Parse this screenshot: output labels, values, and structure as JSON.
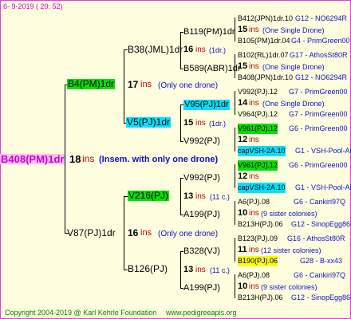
{
  "header": {
    "date": "6-  9-2019 ( 20: 52)"
  },
  "root": {
    "name": "B408(PM)1dr",
    "num": "18",
    "ins": "ins",
    "note": "(Insem. with only one drone)"
  },
  "gen1": [
    {
      "name": "B4(PM)1dr",
      "num": "17",
      "ins": "ins",
      "note": "(Only one drone)"
    },
    {
      "name": "V87(PJ)1dr",
      "num": "16",
      "ins": "ins",
      "note": "(Only one drone)"
    }
  ],
  "gen2": [
    {
      "name": "B38(JML)1dr",
      "num": "16",
      "ins": "ins",
      "note": "(1dr.)"
    },
    {
      "name": "V5(PJ)1dr",
      "num": "15",
      "ins": "ins",
      "note": "(1dr.)"
    },
    {
      "name": "V216(PJ)",
      "num": "13",
      "ins": "ins",
      "note": "(11 c.)"
    },
    {
      "name": "B126(PJ)",
      "num": "13",
      "ins": "ins",
      "note": "(11 c.)"
    }
  ],
  "gen3": [
    {
      "name": "B119(PM)1dr",
      "num": "15",
      "ins": "ins",
      "note": "(One Single Drone)"
    },
    {
      "name": "B589(ABR)1dr",
      "num": "15",
      "ins": "ins",
      "note": "(One Single Drone)"
    },
    {
      "name": "V95(PJ)1dr",
      "num": "14",
      "ins": "ins",
      "note": "(One Single Drone)"
    },
    {
      "name": "V992(PJ)",
      "num": "12",
      "ins": "ins",
      "note": ""
    },
    {
      "name": "V992(PJ)",
      "num": "12",
      "ins": "ins",
      "note": ""
    },
    {
      "name": "A199(PJ)",
      "num": "10",
      "ins": "ins",
      "note": "(9 sister colonies)"
    },
    {
      "name": "B328(VJ)",
      "num": "11",
      "ins": "ins",
      "note": "(12 sister colonies)"
    },
    {
      "name": "A199(PJ)",
      "num": "10",
      "ins": "ins",
      "note": "(9 sister colonies)"
    }
  ],
  "gen4": [
    {
      "left": "B412(JPN)1dr.10",
      "right": "G12 - NO6294R"
    },
    {
      "left": "B105(PM)1dr.04",
      "right": "G4 - PrimGreen00"
    },
    {
      "left": "B102(RL)1dr.07",
      "right": "G17 - AthosSt80R"
    },
    {
      "left": "B408(JPN)1dr.10",
      "right": "G12 - NO6294R"
    },
    {
      "left": "V992(PJ).12",
      "right": "G7 - PrimGreen00"
    },
    {
      "left": "V964(PJ).12",
      "right": "G7 - PrimGreen00"
    },
    {
      "left": "V961(PJ).12",
      "right": "G6 - PrimGreen00"
    },
    {
      "left": "capVSH-2A.10",
      "right": "G1 - VSH-Pool-AR"
    },
    {
      "left": "V961(PJ).12",
      "right": "G6 - PrimGreen00"
    },
    {
      "left": "capVSH-2A.10",
      "right": "G1 - VSH-Pool-AR"
    },
    {
      "left": "A6(PJ).08",
      "right": "G6 - Cankiri97Q"
    },
    {
      "left": "B213H(PJ).06",
      "right": "G12 - SinopEgg86R"
    },
    {
      "left": "B123(PJ).09",
      "right": "G16 - AthosSt80R"
    },
    {
      "left": "B190(PJ).06",
      "right": "G28 - B-xx43"
    },
    {
      "left": "A6(PJ).08",
      "right": "G6 - Cankiri97Q"
    },
    {
      "left": "B213H(PJ).06",
      "right": "G12 - SinopEgg86R"
    }
  ],
  "footer": {
    "copyright": "Copyright 2004-2019 @ Karl Kehrle Foundation",
    "url": "www.pedigreeapis.org"
  }
}
